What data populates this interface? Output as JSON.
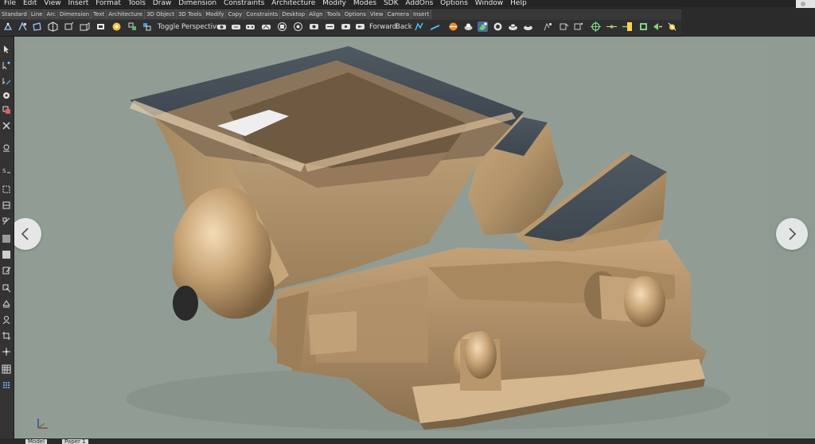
{
  "menu": [
    "File",
    "Edit",
    "View",
    "Insert",
    "Format",
    "Tools",
    "Draw",
    "Dimension",
    "Constraints",
    "Architecture",
    "Modify",
    "Modes",
    "SDK",
    "AddOns",
    "Options",
    "Window",
    "Help"
  ],
  "toolbar_tabs": [
    "Standard",
    "Line",
    "Arc",
    "Dimension",
    "Text",
    "Architecture",
    "3D Object",
    "3D Tools",
    "Modify",
    "Copy",
    "Constraints",
    "Desktop",
    "Align",
    "Tools",
    "Options",
    "View",
    "Camera",
    "Insert"
  ],
  "toolbar": {
    "toggle_perspective": "Toggle Perspective",
    "forward": "Forward",
    "back": "Back"
  },
  "viewport": {
    "background": "#8f9b92",
    "nav_prev_icon": "chevron-left-icon",
    "nav_next_icon": "chevron-right-icon"
  },
  "bottom_tabs": [
    "Model",
    "Paper 1"
  ],
  "colors": {
    "bronze_light": "#e8c9a0",
    "bronze_mid": "#b89a72",
    "bronze_dark": "#6e5a40",
    "steel": "#4a5560"
  }
}
